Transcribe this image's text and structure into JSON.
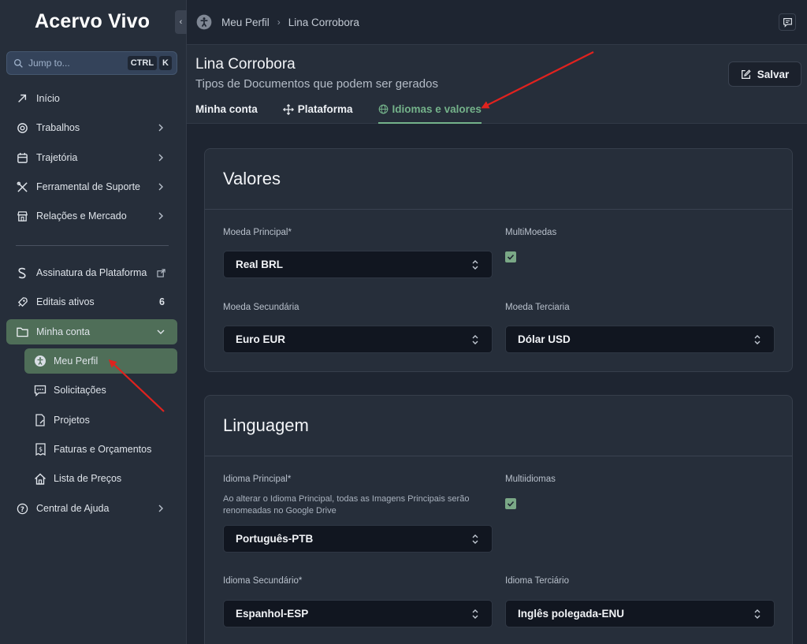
{
  "app": {
    "brand": "Acervo Vivo"
  },
  "search": {
    "placeholder": "Jump to...",
    "shortcut_ctrl": "CTRL",
    "shortcut_key": "K"
  },
  "sidebar": {
    "items": [
      {
        "label": "Início"
      },
      {
        "label": "Trabalhos"
      },
      {
        "label": "Trajetória"
      },
      {
        "label": "Ferramental de Suporte"
      },
      {
        "label": "Relações e Mercado"
      },
      {
        "label": "Assinatura da Plataforma"
      },
      {
        "label": "Editais ativos",
        "count": "6"
      },
      {
        "label": "Minha conta"
      },
      {
        "label": "Central de Ajuda"
      }
    ],
    "subitems": [
      {
        "label": "Meu Perfil"
      },
      {
        "label": "Solicitações"
      },
      {
        "label": "Projetos"
      },
      {
        "label": "Faturas e Orçamentos"
      },
      {
        "label": "Lista de Preços"
      }
    ]
  },
  "breadcrumb": {
    "first": "Meu Perfil",
    "second": "Lina Corrobora"
  },
  "header": {
    "title": "Lina Corrobora",
    "subtitle": "Tipos de Documentos que podem ser gerados",
    "save_label": "Salvar"
  },
  "tabs": [
    {
      "label": "Minha conta"
    },
    {
      "label": "Plataforma"
    },
    {
      "label": "Idiomas e valores",
      "active": true
    }
  ],
  "valores": {
    "title": "Valores",
    "moeda_principal_label": "Moeda Principal*",
    "moeda_principal_value": "Real BRL",
    "multimoedas_label": "MultiMoedas",
    "multimoedas_checked": true,
    "moeda_secundaria_label": "Moeda Secundária",
    "moeda_secundaria_value": "Euro EUR",
    "moeda_terciaria_label": "Moeda Terciaria",
    "moeda_terciaria_value": "Dólar USD"
  },
  "linguagem": {
    "title": "Linguagem",
    "idioma_principal_label": "Idioma Principal*",
    "idioma_principal_help": "Ao alterar o Idioma Principal, todas as Imagens Principais serão renomeadas no Google Drive",
    "idioma_principal_value": "Português-PTB",
    "multiidiomas_label": "Multiidiomas",
    "multiidiomas_checked": true,
    "idioma_secundario_label": "Idioma Secundário*",
    "idioma_secundario_value": "Espanhol-ESP",
    "idioma_terciario_label": "Idioma Terciário",
    "idioma_terciario_value": "Inglês polegada-ENU"
  },
  "colors": {
    "accent": "#74b28a",
    "active_bg": "#4f6e58",
    "annotation": "#e0221e"
  }
}
